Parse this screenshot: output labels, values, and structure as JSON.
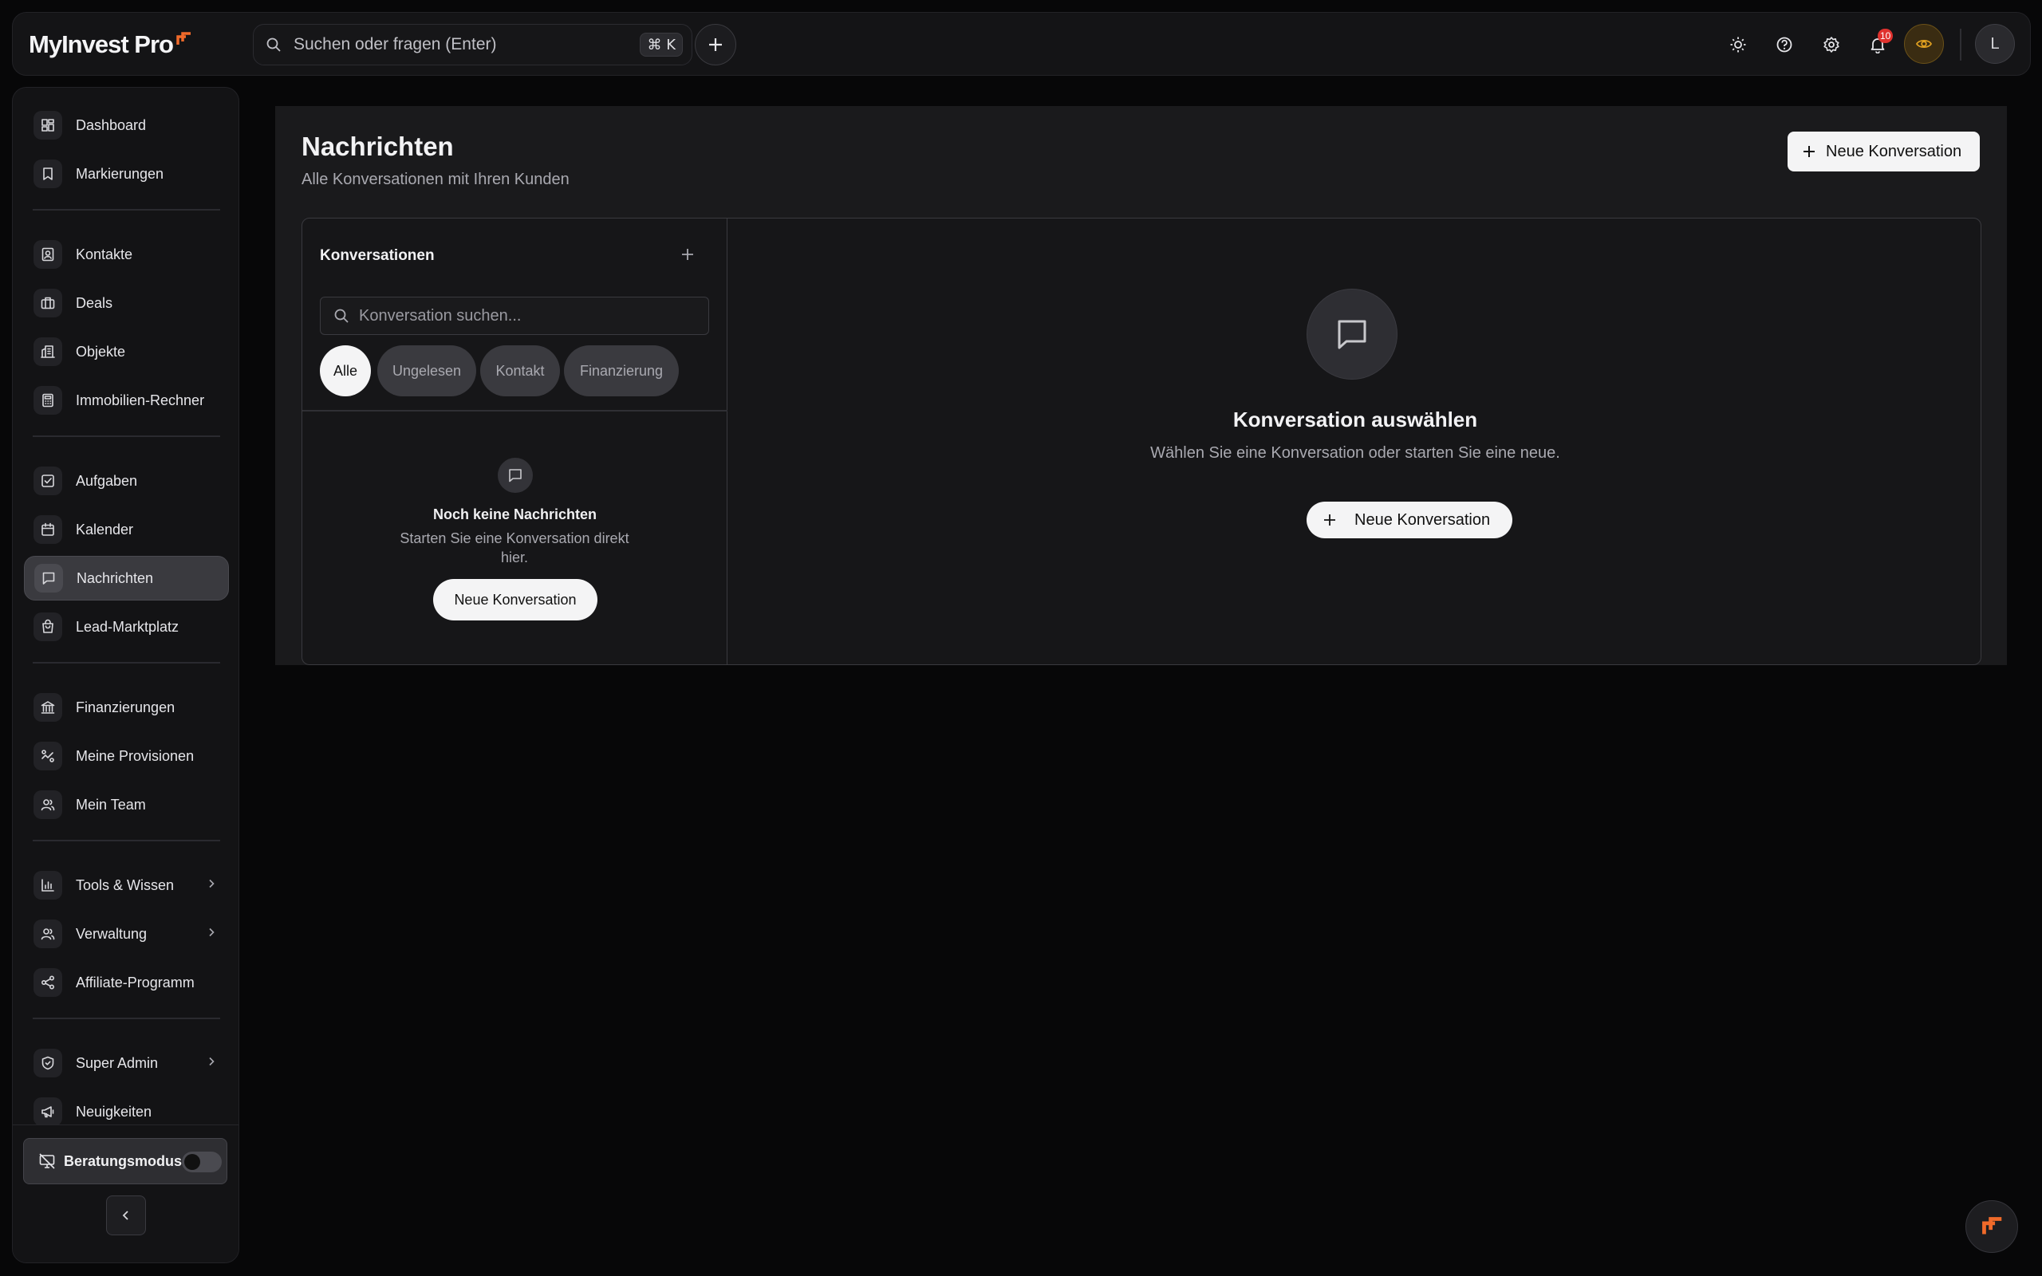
{
  "app": {
    "logo_text": "MyInvest Pro"
  },
  "topbar": {
    "search_placeholder": "Suchen oder fragen (Enter)",
    "shortcut": "⌘ K",
    "notification_count": "10",
    "avatar_initial": "L",
    "accent_color": "#f06a2a"
  },
  "sidebar": {
    "groups": [
      [
        {
          "label": "Dashboard",
          "icon": "dashboard-icon"
        },
        {
          "label": "Markierungen",
          "icon": "bookmark-icon"
        }
      ],
      [
        {
          "label": "Kontakte",
          "icon": "contacts-icon"
        },
        {
          "label": "Deals",
          "icon": "briefcase-icon"
        },
        {
          "label": "Objekte",
          "icon": "building-icon"
        },
        {
          "label": "Immobilien-Rechner",
          "icon": "calculator-icon"
        }
      ],
      [
        {
          "label": "Aufgaben",
          "icon": "task-icon"
        },
        {
          "label": "Kalender",
          "icon": "calendar-icon"
        },
        {
          "label": "Nachrichten",
          "icon": "message-icon",
          "active": true
        },
        {
          "label": "Lead-Marktplatz",
          "icon": "shopping-bag-icon"
        }
      ],
      [
        {
          "label": "Finanzierungen",
          "icon": "bank-icon"
        },
        {
          "label": "Meine Provisionen",
          "icon": "commission-icon"
        },
        {
          "label": "Mein Team",
          "icon": "team-icon"
        }
      ],
      [
        {
          "label": "Tools & Wissen",
          "icon": "chart-icon",
          "chevron": true
        },
        {
          "label": "Verwaltung",
          "icon": "users-icon",
          "chevron": true
        },
        {
          "label": "Affiliate-Programm",
          "icon": "share-icon"
        }
      ],
      [
        {
          "label": "Super Admin",
          "icon": "shield-icon",
          "chevron": true
        },
        {
          "label": "Neuigkeiten",
          "icon": "megaphone-icon"
        }
      ]
    ],
    "consult_mode_label": "Beratungsmodus",
    "consult_mode_on": false
  },
  "main": {
    "title": "Nachrichten",
    "subtitle": "Alle Konversationen mit Ihren Kunden",
    "new_conversation_label": "Neue Konversation",
    "list": {
      "title": "Konversationen",
      "search_placeholder": "Konversation suchen...",
      "filters": [
        "Alle",
        "Ungelesen",
        "Kontakt",
        "Finanzierung"
      ],
      "active_filter": "Alle",
      "empty_title": "Noch keine Nachrichten",
      "empty_text": "Starten Sie eine Konversation direkt hier.",
      "empty_button": "Neue Konversation"
    },
    "detail": {
      "title": "Konversation auswählen",
      "text": "Wählen Sie eine Konversation oder starten Sie eine neue.",
      "button": "Neue Konversation"
    }
  }
}
